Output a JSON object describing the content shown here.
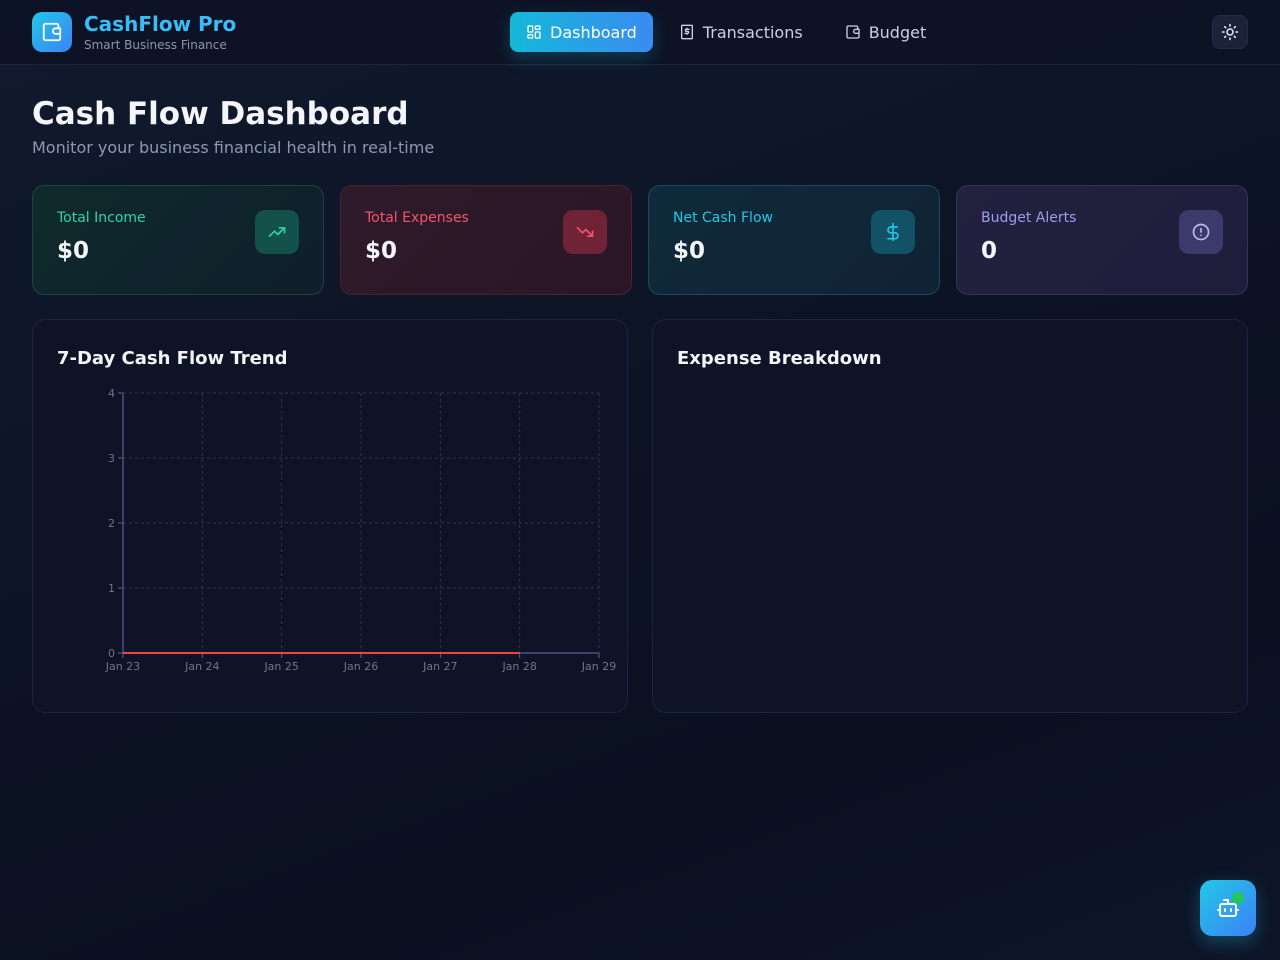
{
  "app": {
    "title": "CashFlow Pro",
    "subtitle": "Smart Business Finance"
  },
  "nav": {
    "items": [
      {
        "label": "Dashboard",
        "icon": "dashboard-grid-icon",
        "active": true
      },
      {
        "label": "Transactions",
        "icon": "receipt-icon",
        "active": false
      },
      {
        "label": "Budget",
        "icon": "wallet-icon",
        "active": false
      }
    ]
  },
  "page": {
    "title": "Cash Flow Dashboard",
    "subtitle": "Monitor your business financial health in real-time"
  },
  "stats": {
    "income": {
      "label": "Total Income",
      "value": "$0",
      "icon": "trending-up-icon",
      "color": "#2dd4a7"
    },
    "expenses": {
      "label": "Total Expenses",
      "value": "$0",
      "icon": "trending-down-icon",
      "color": "#f0556b"
    },
    "net": {
      "label": "Net Cash Flow",
      "value": "$0",
      "icon": "dollar-icon",
      "color": "#22c7e6"
    },
    "alerts": {
      "label": "Budget Alerts",
      "value": "0",
      "icon": "alert-circle-icon",
      "color": "#9b9ef0"
    }
  },
  "trend_panel": {
    "title": "7-Day Cash Flow Trend"
  },
  "breakdown_panel": {
    "title": "Expense Breakdown"
  },
  "chart_data": {
    "type": "line",
    "title": "7-Day Cash Flow Trend",
    "xlabel": "",
    "ylabel": "",
    "categories": [
      "Jan 23",
      "Jan 24",
      "Jan 25",
      "Jan 26",
      "Jan 27",
      "Jan 28",
      "Jan 29"
    ],
    "series": [
      {
        "values": [
          0,
          0,
          0,
          0,
          0,
          0
        ],
        "color": "#ef4444"
      }
    ],
    "yticks": [
      "0",
      "1",
      "2",
      "3",
      "4"
    ],
    "ylim": [
      0,
      4
    ],
    "grid": true,
    "grid_style": "dashed"
  },
  "colors": {
    "accent": "#22c7e6",
    "accent_2": "#3b82f6",
    "background": "#0c1324"
  }
}
